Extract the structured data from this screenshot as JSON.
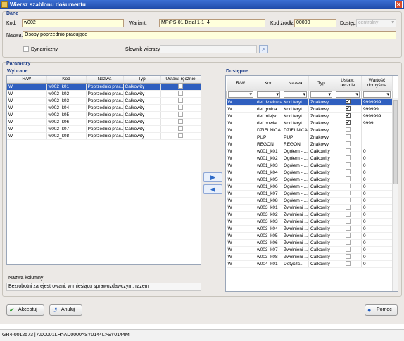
{
  "window": {
    "title": "Wiersz szablonu dokumentu"
  },
  "dane": {
    "legend": "Dane",
    "kod_label": "Kod:",
    "kod_value": "w002",
    "wariant_label": "Wariant:",
    "wariant_value": "MPiPS-01 Dział 1-1_4",
    "kod_zrodla_label": "Kod źródła:",
    "kod_zrodla_value": "00000",
    "dostep_label": "Dostęp:",
    "dostep_value": "centralny",
    "nazwa_label": "Nazwa:",
    "nazwa_value": "Osoby poprzednio pracujące",
    "dynamiczny_label": "Dynamiczny",
    "slownik_label": "Słownik wierszy:",
    "slownik_value": ""
  },
  "parametry": {
    "legend": "Parametry",
    "wybrane": {
      "label": "Wybrane:",
      "headers": [
        "R/W",
        "Kod",
        "Nazwa",
        "Typ",
        "Ustaw. ręcznie"
      ],
      "rows": [
        {
          "rw": "W",
          "kod": "w002_k01",
          "nazwa": "Poprzednio prac...",
          "typ": "Całkowity",
          "selected": true
        },
        {
          "rw": "W",
          "kod": "w002_k02",
          "nazwa": "Poprzednio prac...",
          "typ": "Całkowity",
          "selected": false
        },
        {
          "rw": "W",
          "kod": "w002_k03",
          "nazwa": "Poprzednio prac...",
          "typ": "Całkowity",
          "selected": false
        },
        {
          "rw": "W",
          "kod": "w002_k04",
          "nazwa": "Poprzednio prac...",
          "typ": "Całkowity",
          "selected": false
        },
        {
          "rw": "W",
          "kod": "w002_k05",
          "nazwa": "Poprzednio prac...",
          "typ": "Całkowity",
          "selected": false
        },
        {
          "rw": "W",
          "kod": "w002_k06",
          "nazwa": "Poprzednio prac...",
          "typ": "Całkowity",
          "selected": false
        },
        {
          "rw": "W",
          "kod": "w002_k07",
          "nazwa": "Poprzednio prac...",
          "typ": "Całkowity",
          "selected": false
        },
        {
          "rw": "W",
          "kod": "w002_k08",
          "nazwa": "Poprzednio prac...",
          "typ": "Całkowity",
          "selected": false
        }
      ],
      "nazwa_kolumny_label": "Nazwa kolumny:",
      "nazwa_kolumny_value": "Bezrobotni zarejestrowani; w miesiącu sprawozdawczym; razem"
    },
    "dostepne": {
      "label": "Dostępne:",
      "headers": [
        "R/W",
        "Kod",
        "Nazwa",
        "Typ",
        "Ustaw. ręcznie",
        "Wartość domyślna"
      ],
      "rows": [
        {
          "rw": "W",
          "kod": "def.dzielnica",
          "nazwa": "Kod teryt...",
          "typ": "Znakowy",
          "checked": true,
          "wartosc": "9999999",
          "selected": true
        },
        {
          "rw": "W",
          "kod": "def.gmina",
          "nazwa": "Kod teryt...",
          "typ": "Znakowy",
          "checked": true,
          "wartosc": "999999",
          "selected": false
        },
        {
          "rw": "W",
          "kod": "def.miejsc...",
          "nazwa": "Kod teryt...",
          "typ": "Znakowy",
          "checked": true,
          "wartosc": "9999999",
          "selected": false
        },
        {
          "rw": "W",
          "kod": "def.powiat",
          "nazwa": "Kod teryt...",
          "typ": "Znakowy",
          "checked": true,
          "wartosc": "9999",
          "selected": false
        },
        {
          "rw": "W",
          "kod": "DZIELNICA",
          "nazwa": "DZIELNICA",
          "typ": "Znakowy",
          "checked": false,
          "wartosc": "",
          "selected": false
        },
        {
          "rw": "W",
          "kod": "PUP",
          "nazwa": "PUP",
          "typ": "Znakowy",
          "checked": false,
          "wartosc": "",
          "selected": false
        },
        {
          "rw": "W",
          "kod": "REGON",
          "nazwa": "REGON",
          "typ": "Znakowy",
          "checked": false,
          "wartosc": "",
          "selected": false
        },
        {
          "rw": "W",
          "kod": "w001_k01",
          "nazwa": "Ogółem - ...",
          "typ": "Całkowity",
          "checked": false,
          "wartosc": "0",
          "selected": false
        },
        {
          "rw": "W",
          "kod": "w001_k02",
          "nazwa": "Ogółem - ...",
          "typ": "Całkowity",
          "checked": false,
          "wartosc": "0",
          "selected": false
        },
        {
          "rw": "W",
          "kod": "w001_k03",
          "nazwa": "Ogółem - ...",
          "typ": "Całkowity",
          "checked": false,
          "wartosc": "0",
          "selected": false
        },
        {
          "rw": "W",
          "kod": "w001_k04",
          "nazwa": "Ogółem - ...",
          "typ": "Całkowity",
          "checked": false,
          "wartosc": "0",
          "selected": false
        },
        {
          "rw": "W",
          "kod": "w001_k05",
          "nazwa": "Ogółem - ...",
          "typ": "Całkowity",
          "checked": false,
          "wartosc": "0",
          "selected": false
        },
        {
          "rw": "W",
          "kod": "w001_k06",
          "nazwa": "Ogółem - ...",
          "typ": "Całkowity",
          "checked": false,
          "wartosc": "0",
          "selected": false
        },
        {
          "rw": "W",
          "kod": "w001_k07",
          "nazwa": "Ogółem - ...",
          "typ": "Całkowity",
          "checked": false,
          "wartosc": "0",
          "selected": false
        },
        {
          "rw": "W",
          "kod": "w001_k08",
          "nazwa": "Ogółem - ...",
          "typ": "Całkowity",
          "checked": false,
          "wartosc": "0",
          "selected": false
        },
        {
          "rw": "W",
          "kod": "w003_k01",
          "nazwa": "Zwolnieni ...",
          "typ": "Całkowity",
          "checked": false,
          "wartosc": "0",
          "selected": false
        },
        {
          "rw": "W",
          "kod": "w003_k02",
          "nazwa": "Zwolnieni ...",
          "typ": "Całkowity",
          "checked": false,
          "wartosc": "0",
          "selected": false
        },
        {
          "rw": "W",
          "kod": "w003_k03",
          "nazwa": "Zwolnieni ...",
          "typ": "Całkowity",
          "checked": false,
          "wartosc": "0",
          "selected": false
        },
        {
          "rw": "W",
          "kod": "w003_k04",
          "nazwa": "Zwolnieni ...",
          "typ": "Całkowity",
          "checked": false,
          "wartosc": "0",
          "selected": false
        },
        {
          "rw": "W",
          "kod": "w003_k05",
          "nazwa": "Zwolnieni ...",
          "typ": "Całkowity",
          "checked": false,
          "wartosc": "0",
          "selected": false
        },
        {
          "rw": "W",
          "kod": "w003_k06",
          "nazwa": "Zwolnieni ...",
          "typ": "Całkowity",
          "checked": false,
          "wartosc": "0",
          "selected": false
        },
        {
          "rw": "W",
          "kod": "w003_k07",
          "nazwa": "Zwolnieni ...",
          "typ": "Całkowity",
          "checked": false,
          "wartosc": "0",
          "selected": false
        },
        {
          "rw": "W",
          "kod": "w003_k08",
          "nazwa": "Zwolnieni ...",
          "typ": "Całkowity",
          "checked": false,
          "wartosc": "0",
          "selected": false
        },
        {
          "rw": "W",
          "kod": "w004_k01",
          "nazwa": "Dotyczc...",
          "typ": "Całkowity",
          "checked": false,
          "wartosc": "0",
          "selected": false
        }
      ]
    },
    "arrows": {
      "right": "▶",
      "left": "◀"
    }
  },
  "buttons": {
    "accept": "Akceptuj",
    "cancel": "Anuluj",
    "help": "Pomoc"
  },
  "status": "GR4-0012573 | AD0001LH>AD0000>SY0144L>SY0144M",
  "icons": {
    "accept": "check-icon",
    "cancel": "undo-icon",
    "help": "help-icon",
    "search": "search-icon",
    "close": "close-icon"
  },
  "colors": {
    "selection": "#2f5fbf",
    "title_bar": "#1f4aa8",
    "group_label": "#1e3f8a",
    "field_bg": "#ffffdc"
  }
}
